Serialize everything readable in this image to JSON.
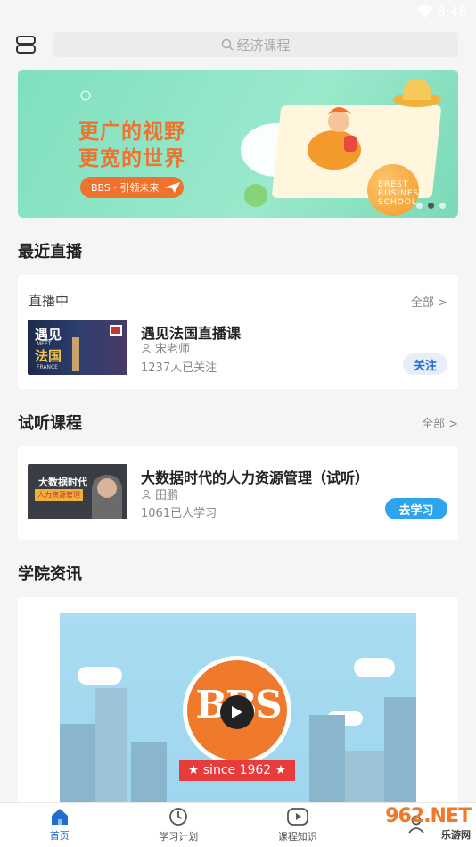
{
  "status_bar": {
    "time": "8:48"
  },
  "search": {
    "placeholder": "经济课程"
  },
  "banner": {
    "headline_1": "更广的视野",
    "headline_2": "更宽的世界",
    "cta": "BBS · 引领未来",
    "school_text": "BREST BUSINESS SCHOOL",
    "slide_count": 3,
    "active_slide": 2
  },
  "live": {
    "section_title": "最近直播",
    "status": "直播中",
    "more": "全部 >",
    "item": {
      "title": "遇见法国直播课",
      "teacher": "宋老师",
      "followers": "1237人已关注",
      "button": "关注",
      "thumb_title": "遇见",
      "thumb_sub": "MEET",
      "thumb_title2": "法国",
      "thumb_sub2": "FRANCE"
    }
  },
  "trial": {
    "section_title": "试听课程",
    "more": "全部 >",
    "item": {
      "title": "大数据时代的人力资源管理（试听）",
      "teacher": "田鹏",
      "learners": "1061已人学习",
      "button": "去学习",
      "thumb_title": "大数据时代",
      "thumb_sub": "人力资源管理"
    }
  },
  "news": {
    "section_title": "学院资讯",
    "video_logo": "BBS",
    "ribbon": "★ since 1962 ★"
  },
  "tabs": [
    {
      "label": "首页",
      "icon": "home-icon",
      "active": true
    },
    {
      "label": "学习计划",
      "icon": "clock-icon",
      "active": false
    },
    {
      "label": "课程知识",
      "icon": "play-icon",
      "active": false
    },
    {
      "label": "",
      "icon": "user-icon",
      "active": false
    }
  ],
  "watermark": {
    "main": "962.NET",
    "sub": "乐游网"
  },
  "colors": {
    "accent": "#1e6fd0",
    "study_button": "#2ea4ee",
    "banner_orange": "#f0722e"
  }
}
